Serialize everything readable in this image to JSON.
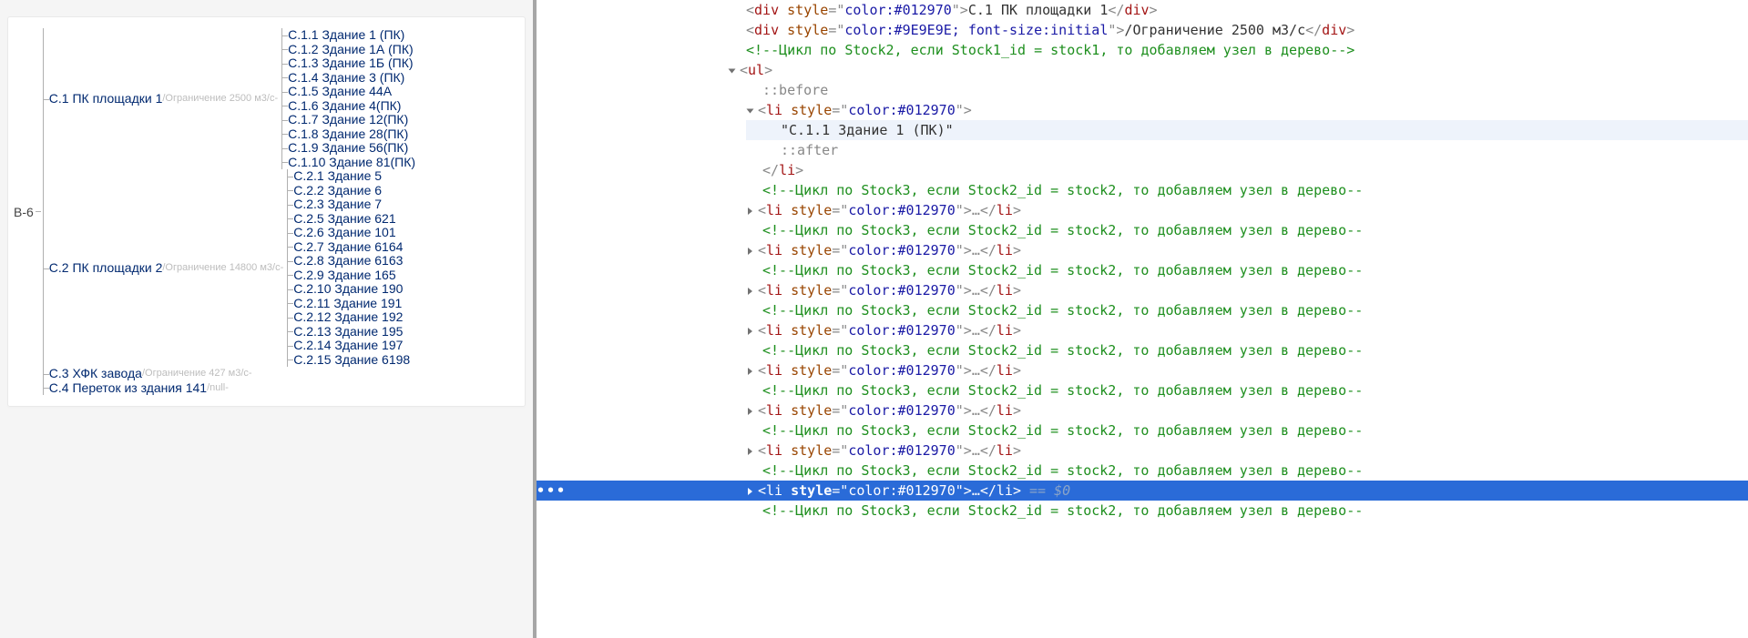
{
  "tree": {
    "root": "В-6",
    "nodes": [
      {
        "label": "С.1 ПК площадки 1",
        "suffix": "/Ограничение 2500 м3/с-",
        "children": [
          "С.1.1 Здание 1 (ПК)",
          "С.1.2 Здание 1А (ПК)",
          "С.1.3 Здание 1Б (ПК)",
          "С.1.4 Здание 3 (ПК)",
          "С.1.5 Здание 44А",
          "С.1.6 Здание 4(ПК)",
          "С.1.7 Здание 12(ПК)",
          "С.1.8 Здание 28(ПК)",
          "С.1.9 Здание 56(ПК)",
          "С.1.10 Здание 81(ПК)"
        ]
      },
      {
        "label": "С.2 ПК площадки 2",
        "suffix": "/Ограничение 14800 м3/с-",
        "children": [
          "С.2.1 Здание 5",
          "С.2.2 Здание 6",
          "С.2.3 Здание 7",
          "С.2.5 Здание 621",
          "С.2.6 Здание 101",
          "С.2.7 Здание 6164",
          "С.2.8 Здание 6163",
          "С.2.9 Здание 165",
          "С.2.10 Здание 190",
          "С.2.11 Здание 191",
          "С.2.12 Здание 192",
          "С.2.13 Здание 195",
          "С.2.14 Здание 197",
          "С.2.15 Здание 6198"
        ]
      },
      {
        "label": "С.3 ХФК завода",
        "suffix": "/Ограничение 427 м3/с-"
      },
      {
        "label": "С.4 Переток из здания 141",
        "suffix": "/null-"
      }
    ]
  },
  "dom": {
    "line0_text": "С.1   ПК площадки 1",
    "line1_text": "/Ограничение 2500 м3/с",
    "style_blue": "color:#012970",
    "style_gray": "color:#9E9E9E; font-size:initial",
    "comment_stock2": "Цикл по  Stock2, если Stock1_id = stock1, то добавляем узел  в дерево",
    "comment_stock3": "Цикл по  Stock3, если Stock2_id = stock2, то добавляем узел  в дерево",
    "pseudo_before": "::before",
    "pseudo_after": "::after",
    "li_text": "\"С.1.1   Здание 1 (ПК)\"",
    "tag_div": "div",
    "tag_ul": "ul",
    "tag_li": "li",
    "attr_style": "style",
    "eq0": "== $0",
    "ellipsis": "…",
    "dots": "•••"
  }
}
